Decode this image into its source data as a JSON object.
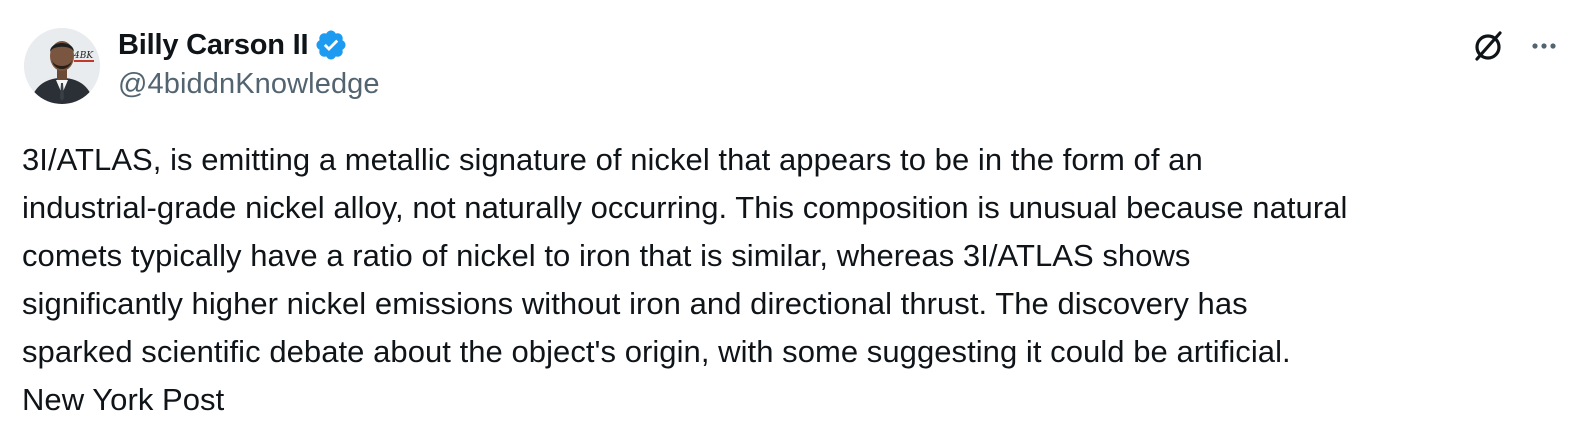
{
  "author": {
    "display_name": "Billy Carson II",
    "handle": "@4biddnKnowledge",
    "verified": true,
    "avatar_text": "4BK"
  },
  "actions": {
    "grok_icon": "grok-icon",
    "more_icon": "more-icon"
  },
  "tweet": {
    "lines": [
      "3I/ATLAS, is emitting a metallic signature of nickel that appears to be in the form of an",
      "industrial-grade nickel alloy, not naturally occurring. This composition is unusual because natural",
      "comets typically have a ratio of nickel to iron that is similar, whereas 3I/ATLAS shows",
      "significantly higher nickel emissions without iron and directional thrust. The discovery has",
      "sparked scientific debate about the object's origin, with some suggesting it could be artificial.",
      "New York Post"
    ]
  },
  "colors": {
    "text": "#0f1419",
    "secondary": "#536471",
    "verified": "#1d9bf0"
  }
}
